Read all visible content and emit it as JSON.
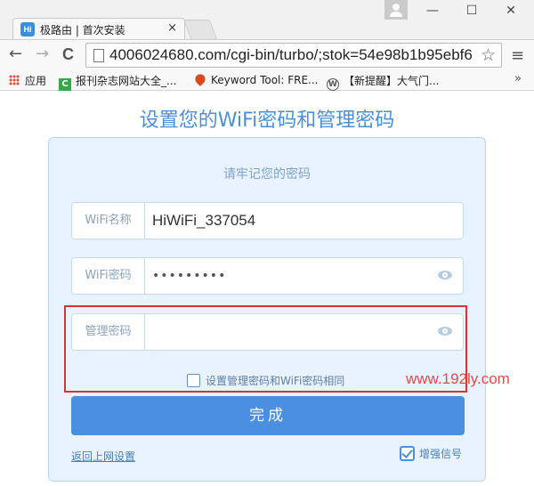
{
  "browser": {
    "tab_logo": "Hi",
    "tab_title": "极路由 | 首次安装",
    "tab_close": "×",
    "window_buttons": [
      "—",
      "☐",
      "✕"
    ],
    "nav_back": "←",
    "nav_forward": "→",
    "nav_reload": "C",
    "url": "4006024680.com/cgi-bin/turbo/;stok=54e98b1b95ebf6",
    "bookmark_star": "☆",
    "menu": "≡",
    "bookmarks": [
      {
        "label": "应用",
        "icon": "apps-grid-icon"
      },
      {
        "label": "报刊杂志网站大全_...",
        "icon": "green-c-icon"
      },
      {
        "label": "Keyword Tool: FRE...",
        "icon": "flame-icon"
      },
      {
        "label": "【新提醒】大气门...",
        "icon": "wordpress-icon"
      }
    ],
    "bookmarks_more": "»"
  },
  "page": {
    "heading": "设置您的WiFi密码和管理密码",
    "subtitle": "请牢记您的密码",
    "fields": [
      {
        "label": "WiFi名称",
        "value": "HiWiFi_337054",
        "placeholder": ""
      },
      {
        "label": "WiFi密码",
        "value": "•••••••••",
        "placeholder": ""
      },
      {
        "label": "管理密码",
        "value": "",
        "placeholder": ""
      }
    ],
    "same_password_checkbox": "设置管理密码和WiFi密码相同",
    "submit": "完成",
    "back_link": "返回上网设置",
    "boost_signal": "增强信号",
    "watermark": "www.192ly.com"
  },
  "colors": {
    "accent": "#4a8fe0",
    "heading": "#4a8fd8",
    "card_bg": "#e8f3ff",
    "highlight": "#d2343a"
  }
}
